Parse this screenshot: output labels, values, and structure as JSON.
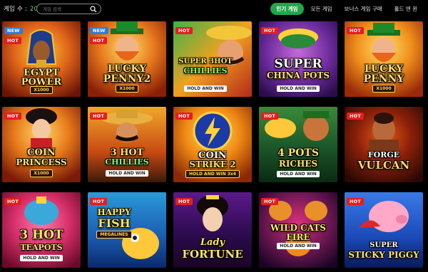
{
  "header": {
    "count_label": "게임 수 :",
    "count_value": "20",
    "search_placeholder": "게임 검색"
  },
  "tabs": [
    {
      "label": "인기 게임",
      "active": true
    },
    {
      "label": "모든 게임",
      "active": false
    },
    {
      "label": "보너스 게임 구매",
      "active": false
    },
    {
      "label": "홀드 앤 윈",
      "active": false
    }
  ],
  "games": [
    {
      "badges": [
        "NEW",
        "HOT"
      ],
      "title1": "EGYPT",
      "title2": "POWER",
      "sub": "X1000"
    },
    {
      "badges": [
        "NEW",
        "HOT"
      ],
      "title1": "LUCKY",
      "title2": "PENNY2",
      "sub": "X1000"
    },
    {
      "badges": [
        "HOT"
      ],
      "title1": "SUPER 3HOT",
      "title2": "CHILLIES",
      "sub": "HOLD AND WIN"
    },
    {
      "badges": [
        "HOT"
      ],
      "title1": "SUPER",
      "title2": "CHINA POTS",
      "sub": "HOLD AND WIN"
    },
    {
      "badges": [
        "HOT"
      ],
      "title1": "LUCKY",
      "title2": "PENNY",
      "sub": "X1000"
    },
    {
      "badges": [
        "HOT"
      ],
      "title1": "COIN",
      "title2": "PRINCESS",
      "sub": "X1000"
    },
    {
      "badges": [
        "HOT"
      ],
      "title1": "3 HOT",
      "title2": "CHILLIES",
      "sub": "HOLD AND WIN"
    },
    {
      "badges": [
        "HOT"
      ],
      "title1": "COIN",
      "title2": "STRIKE 2",
      "sub": "HOLD AND WIN 3x4"
    },
    {
      "badges": [
        "HOT"
      ],
      "title1": "4 POTS",
      "title2": "RICHES",
      "sub": "HOLD AND WIN"
    },
    {
      "badges": [
        "HOT"
      ],
      "title1": "FORGE",
      "title2": "VULCAN",
      "sub": ""
    },
    {
      "badges": [
        "HOT"
      ],
      "title1": "3 HOT",
      "title2": "TEAPOTS",
      "sub": "HOLD AND WIN"
    },
    {
      "badges": [
        "HOT"
      ],
      "title1": "HAPPY",
      "title2": "FISH",
      "sub": "MEGALINES"
    },
    {
      "badges": [
        "HOT"
      ],
      "title1": "Lady",
      "title2": "FORTUNE",
      "sub": ""
    },
    {
      "badges": [
        "HOT"
      ],
      "title1": "WILD CATS",
      "title2": "FIRE",
      "sub": "HOLD AND WIN"
    },
    {
      "badges": [
        "HOT"
      ],
      "title1": "SUPER",
      "title2": "STICKY PIGGY",
      "sub": ""
    }
  ],
  "colors": {
    "accent_green": "#1fa84a",
    "hot_red": "#e61d1d",
    "new_blue": "#2d7de0",
    "count_green": "#6fd84a"
  }
}
